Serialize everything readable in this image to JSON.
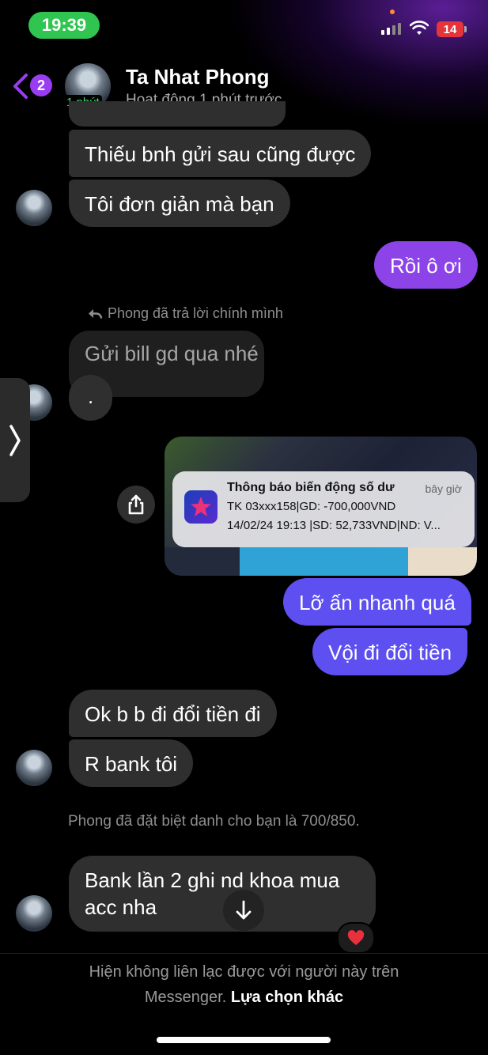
{
  "status_bar": {
    "time": "19:39",
    "battery": "14"
  },
  "header": {
    "back_count": "2",
    "contact_name": "Ta Nhat Phong",
    "active_badge": "1 phút",
    "status": "Hoạt động 1 phút trước"
  },
  "messages": {
    "m1": "Thiếu bnh gửi sau cũng được",
    "m2": "Tôi đơn giản mà bạn",
    "m3": "Rồi ô ơi",
    "reply_label": "Phong đã trả lời chính mình",
    "replied_quote": "Gửi bill gd qua nhé",
    "m4": ".",
    "m5": "Lỡ ấn nhanh quá",
    "m6": "Vội đi đổi tiền",
    "m7": "Ok b b đi đổi tiền đi",
    "m8": "R bank tôi",
    "system_note": "Phong đã đặt biệt danh cho bạn là 700/850.",
    "m9_line1": "Bank lần 2 ghi nd khoa mua",
    "m9_line2": "acc nha"
  },
  "notification": {
    "title": "Thông báo biến động số dư",
    "time": "bây giờ",
    "line1": "TK 03xxx158|GD: -700,000VND",
    "line2": "14/02/24 19:13 |SD: 52,733VND|ND: V..."
  },
  "footer": {
    "line1": "Hiện không liên lạc được với người này trên",
    "line2_prefix": "Messenger.",
    "line2_action": "Lựa chọn khác"
  },
  "icons": {
    "reaction": "heart-icon",
    "share": "share-icon",
    "scroll_down": "arrow-down-icon"
  },
  "colors": {
    "incoming_bubble": "#2f2f2f",
    "outgoing_bubble": "#5d4ff0",
    "accent_purple": "#9a3cf2",
    "active_green": "#45d66a"
  }
}
